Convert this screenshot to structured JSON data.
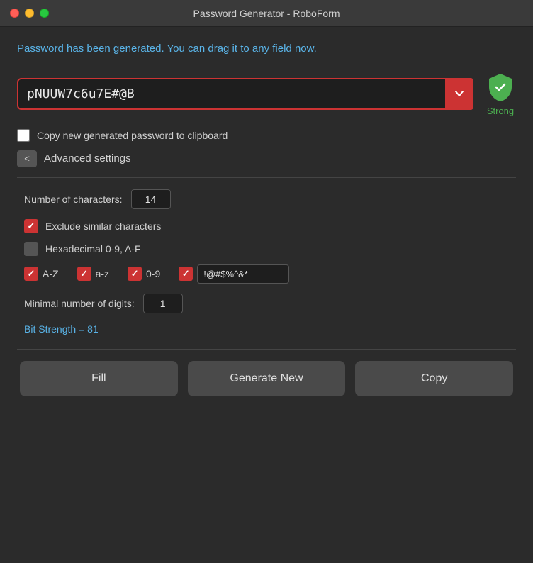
{
  "titleBar": {
    "title": "Password Generator - RoboForm"
  },
  "statusMessage": "Password has been generated. You can drag it to any field now.",
  "passwordField": {
    "value": "pNUUW7c6u7E#@B",
    "placeholder": ""
  },
  "strengthLabel": "Strong",
  "clipboardCheckbox": {
    "label": "Copy new generated password to clipboard",
    "checked": false
  },
  "advancedSettings": {
    "toggleLabel": "Advanced settings",
    "toggleIcon": "<",
    "numCharsLabel": "Number of characters:",
    "numCharsValue": "14",
    "excludeSimilarLabel": "Exclude similar characters",
    "excludeSimilarChecked": true,
    "hexadecimalLabel": "Hexadecimal 0-9, A-F",
    "hexadecimalChecked": false,
    "charTypes": [
      {
        "label": "A-Z",
        "checked": true
      },
      {
        "label": "a-z",
        "checked": true
      },
      {
        "label": "0-9",
        "checked": true
      }
    ],
    "specialCharsChecked": true,
    "specialCharsValue": "!@#$%^&*",
    "minDigitsLabel": "Minimal number of digits:",
    "minDigitsValue": "1",
    "bitStrength": "Bit Strength = 81"
  },
  "buttons": {
    "fill": "Fill",
    "generateNew": "Generate New",
    "copy": "Copy"
  }
}
